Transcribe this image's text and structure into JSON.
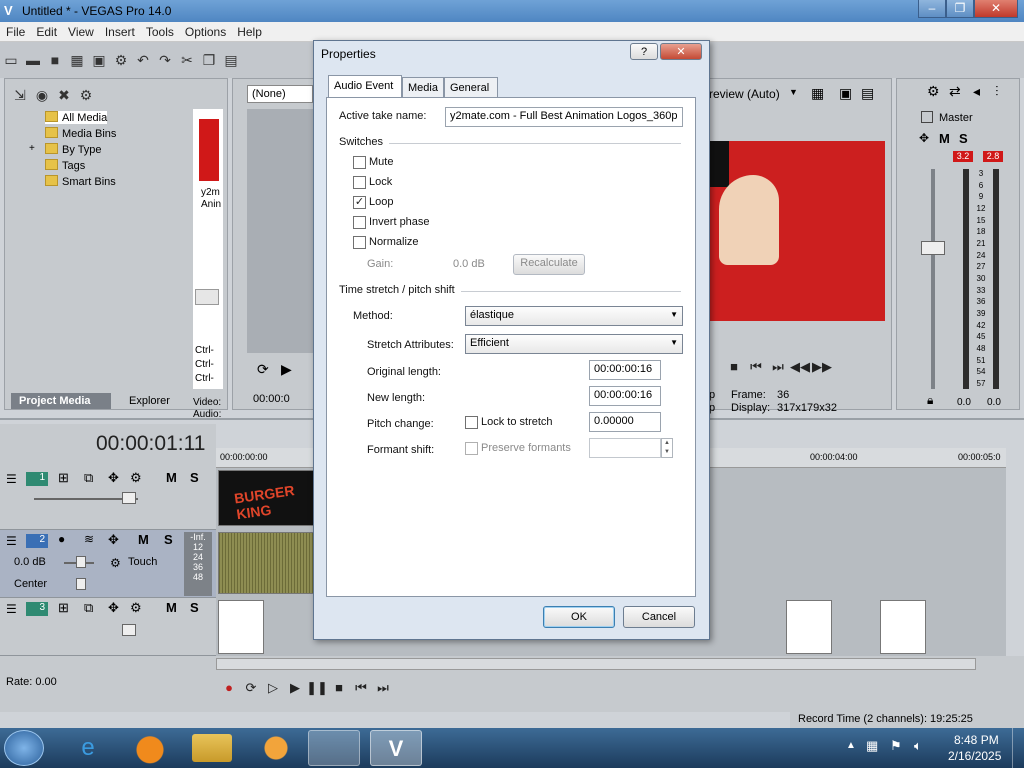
{
  "window": {
    "title": "Untitled * - VEGAS Pro 14.0",
    "min": "‒",
    "max": "❐",
    "close": "✕"
  },
  "menu": [
    "File",
    "Edit",
    "View",
    "Insert",
    "Tools",
    "Options",
    "Help"
  ],
  "project_media": {
    "tree": [
      "All Media",
      "Media Bins",
      "By Type",
      "Tags",
      "Smart Bins"
    ],
    "expander": "+",
    "thumb_caption": [
      "y2m",
      "Anin"
    ],
    "ctrl_rows": [
      "Ctrl-",
      "Ctrl-",
      "Ctrl-"
    ],
    "info_rows": [
      "Video:",
      "Audio:"
    ],
    "tabs": [
      "Project Media",
      "Explorer"
    ]
  },
  "trimmer": {
    "dropdown": "(None)",
    "timecode": "00:00:0"
  },
  "preview": {
    "quality": "review (Auto)",
    "frame_label": "Frame:",
    "frame_value": "36",
    "display_label": "Display:",
    "display_value": "317x179x32",
    "left_stub_1": "p",
    "left_stub_2": "p"
  },
  "master": {
    "label": "Master",
    "peak_left": "3.2",
    "peak_right": "2.8",
    "scale": [
      "3",
      "6",
      "9",
      "12",
      "15",
      "18",
      "21",
      "24",
      "27",
      "30",
      "33",
      "36",
      "39",
      "42",
      "45",
      "48",
      "51",
      "54",
      "57"
    ],
    "level_left": "0.0",
    "level_right": "0.0"
  },
  "timeline": {
    "timecode": "00:00:01:11",
    "ruler": [
      "00:00:00:00",
      "00:00:04:00",
      "00:00:05:0"
    ],
    "tracks": [
      {
        "num": "1",
        "type": "video"
      },
      {
        "num": "2",
        "type": "audio",
        "volume": "0.0 dB",
        "pan": "Center",
        "mode": "Touch",
        "inf": "-Inf.",
        "meter_labels": [
          "12",
          "24",
          "36",
          "48"
        ]
      },
      {
        "num": "3",
        "type": "video"
      }
    ],
    "clip_title": "BURGER KING",
    "m_label": "M",
    "s_label": "S"
  },
  "bottom": {
    "rate": "Rate: 0.00",
    "record_time": "Record Time (2 channels): 19:25:25"
  },
  "dialog": {
    "title": "Properties",
    "help": "?",
    "close": "✕",
    "tabs": [
      "Audio Event",
      "Media",
      "General"
    ],
    "active_take_label": "Active take name:",
    "active_take_value": "y2mate.com - Full Best Animation Logos_360p",
    "switches_header": "Switches",
    "switches": [
      {
        "label": "Mute",
        "checked": false
      },
      {
        "label": "Lock",
        "checked": false
      },
      {
        "label": "Loop",
        "checked": true
      },
      {
        "label": "Invert phase",
        "checked": false
      },
      {
        "label": "Normalize",
        "checked": false
      }
    ],
    "gain_label": "Gain:",
    "gain_value": "0.0 dB",
    "recalculate": "Recalculate",
    "stretch_header": "Time stretch / pitch shift",
    "method_label": "Method:",
    "method_value": "élastique",
    "stretch_attr_label": "Stretch Attributes:",
    "stretch_attr_value": "Efficient",
    "orig_len_label": "Original length:",
    "orig_len_value": "00:00:00:16",
    "new_len_label": "New length:",
    "new_len_value": "00:00:00:16",
    "pitch_label": "Pitch change:",
    "lock_to_stretch": "Lock to stretch",
    "pitch_value": "0.00000",
    "formant_label": "Formant shift:",
    "preserve_formants": "Preserve formants",
    "ok": "OK",
    "cancel": "Cancel"
  },
  "taskbar": {
    "time": "8:48 PM",
    "date": "2/16/2025"
  }
}
